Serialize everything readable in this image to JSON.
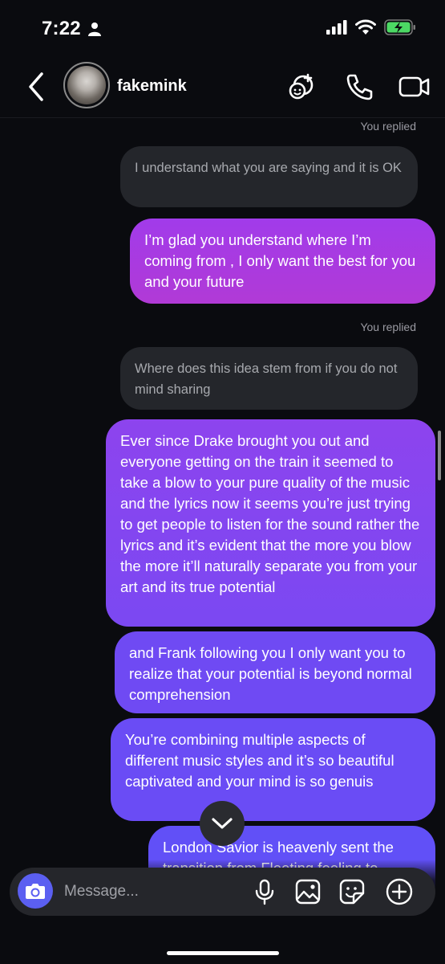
{
  "status_bar": {
    "time": "7:22"
  },
  "header": {
    "username": "fakemink"
  },
  "messages": [
    {
      "kind": "replied",
      "text": "You replied"
    },
    {
      "kind": "received",
      "text": "I understand what you are saying and it is OK"
    },
    {
      "kind": "sent",
      "text": "I’m glad you understand where I’m coming from , I only want the best for you and your future"
    },
    {
      "kind": "replied",
      "text": "You replied"
    },
    {
      "kind": "received",
      "text": "Where does this idea stem from if you do not mind sharing"
    },
    {
      "kind": "sent",
      "text": "Ever since Drake brought you out and everyone getting on the train it seemed to take a blow to your pure quality of the music and the lyrics now it seems you’re just trying to get people to listen for the sound rather the lyrics  and it’s evident that the more you blow the more it’ll naturally separate you from your art and its true potential"
    },
    {
      "kind": "sent",
      "text": "and Frank following you I only want you to realize that your potential is beyond normal comprehension"
    },
    {
      "kind": "sent",
      "text": "You’re combining multiple aspects of different music styles and it’s so beautiful captivated and your mind is so genuis"
    },
    {
      "kind": "sent",
      "text": "London Savior is heavenly sent the transition from Fleeting feeling to"
    }
  ],
  "composer": {
    "placeholder": "Message..."
  },
  "colors": {
    "sent_top": "#b43be0",
    "sent_mid": "#8a45ee",
    "sent_bottom": "#6a4cf5",
    "received_bg": "#24262b",
    "camera_button": "#5b5ff1",
    "battery": "#4cd964"
  },
  "icons": [
    "person-icon",
    "signal-icon",
    "wifi-icon",
    "battery-charging-icon",
    "back-chevron-icon",
    "effects-icon",
    "phone-icon",
    "video-call-icon",
    "camera-icon",
    "microphone-icon",
    "gallery-icon",
    "sticker-icon",
    "plus-icon",
    "chevron-down-icon"
  ]
}
